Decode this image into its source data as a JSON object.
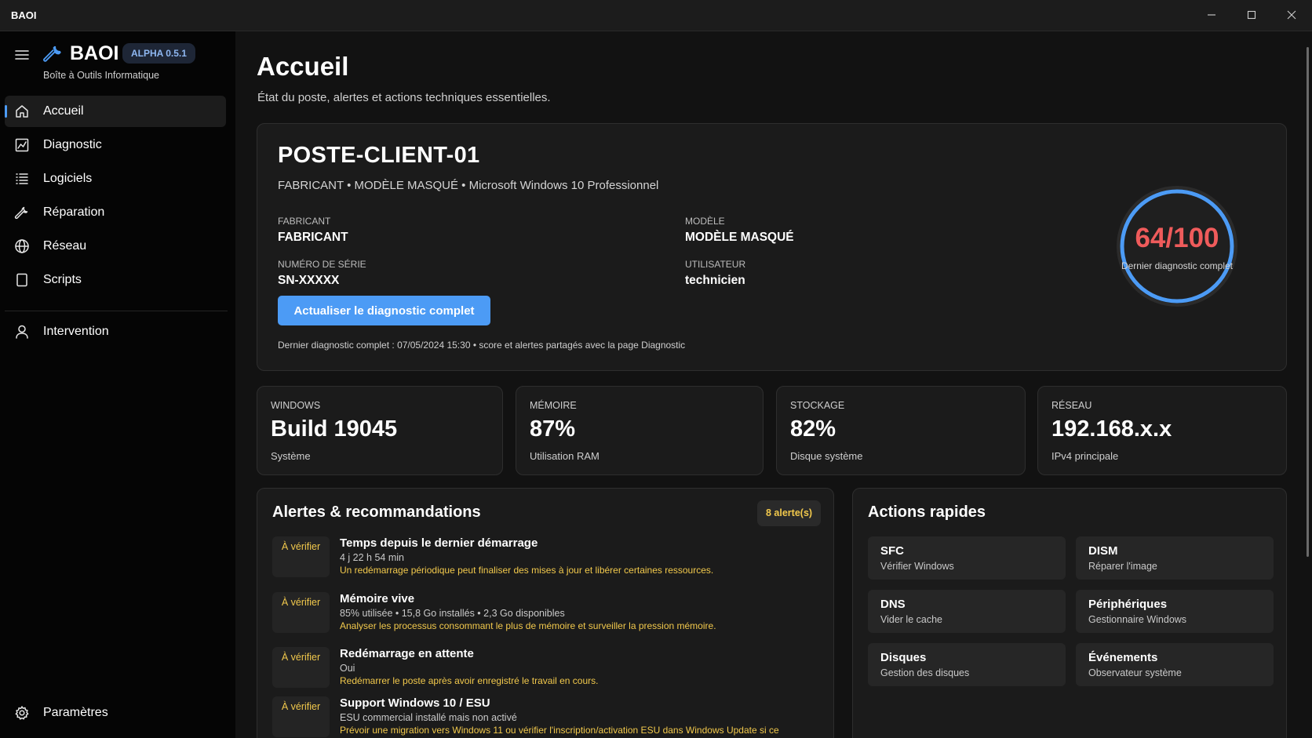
{
  "window": {
    "title": "BAOI"
  },
  "brand": {
    "name": "BAOI",
    "version_badge": "ALPHA 0.5.1",
    "subtitle": "Boîte à Outils Informatique"
  },
  "nav": {
    "items": [
      {
        "label": "Accueil",
        "icon": "home-icon",
        "active": true
      },
      {
        "label": "Diagnostic",
        "icon": "chart-icon",
        "active": false
      },
      {
        "label": "Logiciels",
        "icon": "list-icon",
        "active": false
      },
      {
        "label": "Réparation",
        "icon": "wrench-icon",
        "active": false
      },
      {
        "label": "Réseau",
        "icon": "globe-icon",
        "active": false
      },
      {
        "label": "Scripts",
        "icon": "document-icon",
        "active": false
      },
      {
        "label": "Intervention",
        "icon": "person-icon",
        "active": false
      }
    ],
    "settings_label": "Paramètres"
  },
  "page": {
    "title": "Accueil",
    "subtitle": "État du poste, alertes et actions techniques essentielles."
  },
  "device": {
    "hostname": "POSTE-CLIENT-01",
    "summary": "FABRICANT • MODÈLE MASQUÉ • Microsoft Windows 10 Professionnel",
    "fields": {
      "manufacturer": {
        "label": "FABRICANT",
        "value": "FABRICANT"
      },
      "model": {
        "label": "MODÈLE",
        "value": "MODÈLE MASQUÉ"
      },
      "serial": {
        "label": "NUMÉRO DE SÉRIE",
        "value": "SN-XXXXX"
      },
      "user": {
        "label": "UTILISATEUR",
        "value": "technicien"
      }
    },
    "refresh_button": "Actualiser le diagnostic complet",
    "last_diag_note": "Dernier diagnostic complet : 07/05/2024 15:30 • score et alertes partagés avec la page Diagnostic",
    "score": {
      "text": "64/100",
      "value": 64,
      "max": 100,
      "label": "Dernier diagnostic complet",
      "color": "#ef5b5b",
      "ring_color": "#4c9bf5"
    }
  },
  "stats": [
    {
      "label": "WINDOWS",
      "value": "Build 19045",
      "sub": "Système"
    },
    {
      "label": "MÉMOIRE",
      "value": "87%",
      "sub": "Utilisation RAM"
    },
    {
      "label": "STOCKAGE",
      "value": "82%",
      "sub": "Disque système"
    },
    {
      "label": "RÉSEAU",
      "value": "192.168.x.x",
      "sub": "IPv4 principale"
    }
  ],
  "alerts": {
    "title": "Alertes & recommandations",
    "count_badge": "8 alerte(s)",
    "items": [
      {
        "tag": "À vérifier",
        "title": "Temps depuis le dernier démarrage",
        "detail": "4 j 22 h 54 min",
        "advice": "Un redémarrage périodique peut finaliser des mises à jour et libérer certaines ressources."
      },
      {
        "tag": "À vérifier",
        "title": "Mémoire vive",
        "detail": "85% utilisée • 15,8 Go installés • 2,3 Go disponibles",
        "advice": "Analyser les processus consommant le plus de mémoire et surveiller la pression mémoire."
      },
      {
        "tag": "À vérifier",
        "title": "Redémarrage en attente",
        "detail": "Oui",
        "advice": "Redémarrer le poste après avoir enregistré le travail en cours."
      },
      {
        "tag": "À vérifier",
        "title": "Support Windows 10 / ESU",
        "detail": "ESU commercial installé mais non activé",
        "advice": "Prévoir une migration vers Windows 11 ou vérifier l'inscription/activation ESU dans Windows Update si ce"
      }
    ]
  },
  "quick_actions": {
    "title": "Actions rapides",
    "items": [
      {
        "title": "SFC",
        "sub": "Vérifier Windows"
      },
      {
        "title": "DISM",
        "sub": "Réparer l'image"
      },
      {
        "title": "DNS",
        "sub": "Vider le cache"
      },
      {
        "title": "Périphériques",
        "sub": "Gestionnaire Windows"
      },
      {
        "title": "Disques",
        "sub": "Gestion des disques"
      },
      {
        "title": "Événements",
        "sub": "Observateur système"
      }
    ]
  },
  "colors": {
    "accent": "#4c9bf5",
    "warning": "#f2c94c",
    "danger": "#ef5b5b",
    "background": "#121212",
    "card": "#1b1b1b"
  }
}
